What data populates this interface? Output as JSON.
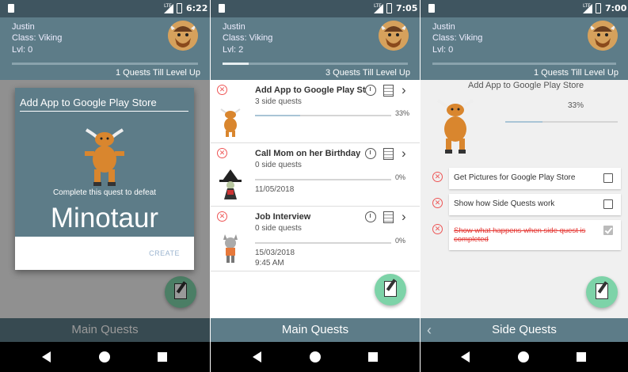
{
  "screens": [
    {
      "time": "6:22",
      "header": {
        "name": "Justin",
        "class": "Class: Viking",
        "level": "Lvl: 0",
        "till": "1 Quests Till Level Up",
        "xp_fraction": 0
      },
      "dialog": {
        "input_value": "Add App to Google Play Store",
        "defeat_text": "Complete this quest to defeat",
        "monster_name": "Minotaur",
        "create_label": "CREATE"
      },
      "bottom_title": "Main Quests"
    },
    {
      "time": "7:05",
      "header": {
        "name": "Justin",
        "class": "Class: Viking",
        "level": "Lvl: 2",
        "till": "3 Quests Till Level Up",
        "xp_fraction": 0.14
      },
      "quests": [
        {
          "title": "Add App to Google Play Store",
          "sub": "3 side quests",
          "pct": "33%",
          "progress": 0.33,
          "date": "",
          "time": "",
          "monster": "minotaur"
        },
        {
          "title": "Call Mom on her Birthday",
          "sub": "0 side quests",
          "pct": "0%",
          "progress": 0,
          "date": "11/05/2018",
          "time": "",
          "monster": "witch"
        },
        {
          "title": "Job Interview",
          "sub": "0 side quests",
          "pct": "0%",
          "progress": 0,
          "date": "15/03/2018",
          "time": "9:45 AM",
          "monster": "cat"
        }
      ],
      "bottom_title": "Main Quests"
    },
    {
      "time": "7:00",
      "header": {
        "name": "Justin",
        "class": "Class: Viking",
        "level": "Lvl: 0",
        "till": "1 Quests Till Level Up",
        "xp_fraction": 0
      },
      "quest": {
        "title": "Add App to Google Play Store",
        "pct": "33%",
        "progress": 0.33
      },
      "side_quests": [
        {
          "label": "Get Pictures for Google Play Store",
          "done": false
        },
        {
          "label": "Show how Side Quests work",
          "done": false
        },
        {
          "label": "Show what happens when side quest is completed",
          "done": true
        }
      ],
      "bottom_title": "Side Quests"
    }
  ],
  "icons": {
    "status_sd": "sd-card-icon",
    "lte": "LTE",
    "avatar": "viking-avatar-icon",
    "fab": "quest-scroll-quill-icon"
  },
  "colors": {
    "primary": "#5d7c88",
    "status": "#3f5560",
    "fab": "#7dd3a8",
    "error": "#e53935"
  }
}
